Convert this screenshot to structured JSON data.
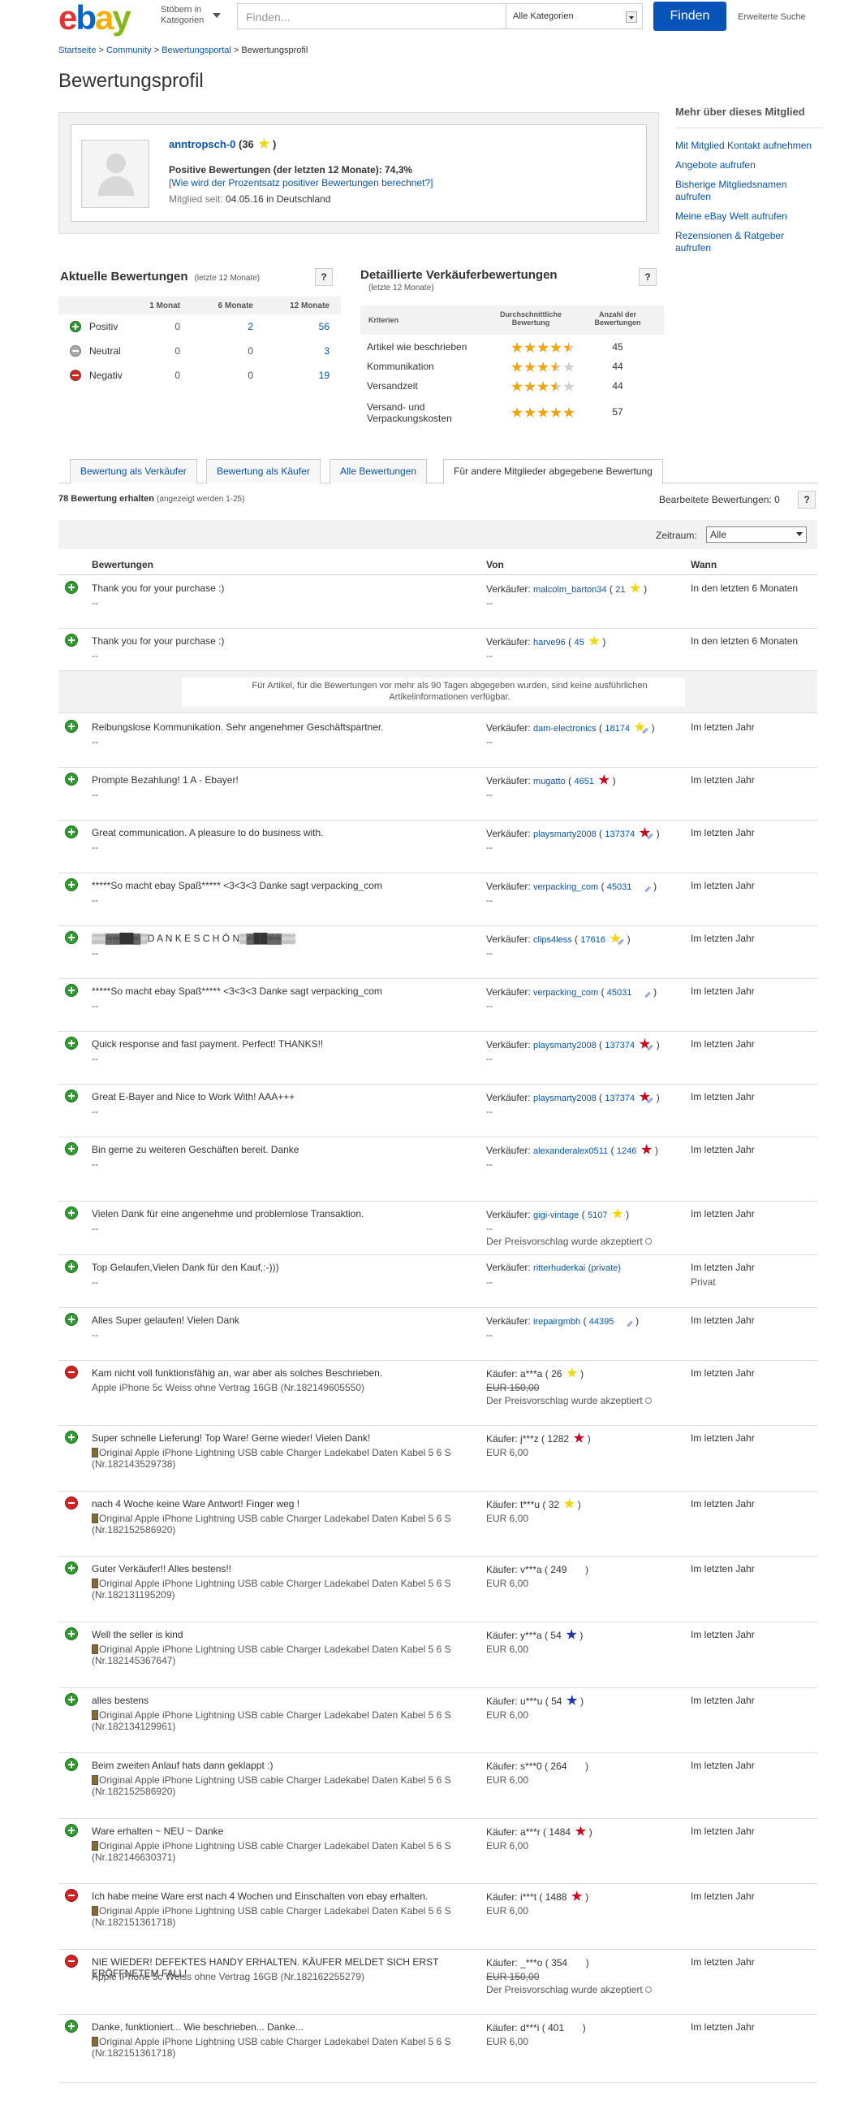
{
  "header": {
    "logo": {
      "e": "e",
      "b": "b",
      "a": "a",
      "y": "y"
    },
    "browse_label": "Stöbern in Kategorien",
    "search_placeholder": "Finden...",
    "category_value": "Alle Kategorien",
    "find_button": "Finden",
    "advanced_link": "Erweiterte Suche"
  },
  "breadcrumb": {
    "items": [
      "Startseite",
      "Community",
      "Bewertungsportal",
      "Bewertungsprofil"
    ],
    "sep": ">"
  },
  "page_title": "Bewertungsprofil",
  "profile": {
    "username": "anntropsch-0",
    "score_open": "(",
    "score": "36",
    "score_close": ")",
    "positive_text": "Positive Bewertungen (der letzten 12 Monate): 74,3%",
    "calc_link": "[Wie wird der Prozentsatz positiver Bewertungen berechnet?]",
    "since_label": "Mitglied seit:",
    "since_value": "04.05.16 in Deutschland"
  },
  "sidebar": {
    "title": "Mehr über dieses Mitglied",
    "links": [
      "Mit Mitglied Kontakt aufnehmen",
      "Angebote aufrufen",
      "Bisherige Mitgliedsnamen aufrufen",
      "Meine eBay Welt aufrufen",
      "Rezensionen & Ratgeber aufrufen"
    ]
  },
  "current_ratings": {
    "title": "Aktuelle Bewertungen",
    "period": "(letzte 12 Monate)",
    "help": "?",
    "columns": [
      "1 Monat",
      "6 Monate",
      "12 Monate"
    ],
    "rows": [
      {
        "label": "Positiv",
        "type": "pos",
        "v1": "0",
        "v6": "2",
        "v12": "56"
      },
      {
        "label": "Neutral",
        "type": "neu",
        "v1": "0",
        "v6": "0",
        "v12": "3"
      },
      {
        "label": "Negativ",
        "type": "neg",
        "v1": "0",
        "v6": "0",
        "v12": "19"
      }
    ]
  },
  "detailed_ratings": {
    "title": "Detaillierte Verkäuferbewertungen",
    "period": "(letzte 12 Monate)",
    "help": "?",
    "col_criteria": "Kriterien",
    "col_avg": "Durchschnittliche Bewertung",
    "col_count": "Anzahl der Bewertungen",
    "rows": [
      {
        "label": "Artikel wie beschrieben",
        "stars": 4.5,
        "count": "45"
      },
      {
        "label": "Kommunikation",
        "stars": 3.5,
        "count": "44"
      },
      {
        "label": "Versandzeit",
        "stars": 3.5,
        "count": "44"
      },
      {
        "label": "Versand- und Verpackungskosten",
        "stars": 5,
        "count": "57"
      }
    ]
  },
  "tabs": [
    "Bewertung als Verkäufer",
    "Bewertung als Käufer",
    "Alle Bewertungen",
    "Für andere Mitglieder abgegebene Bewertung"
  ],
  "count_text": "78 Bewertung erhalten",
  "count_sub": "(angezeigt werden 1-25)",
  "revised_text": "Bearbeitete Bewertungen: 0",
  "revised_help": "?",
  "timeframe_label": "Zeitraum:",
  "timeframe_value": "Alle",
  "columns": {
    "feedback": "Bewertungen",
    "from": "Von",
    "when": "Wann"
  },
  "info_text": "Für Artikel, für die Bewertungen vor mehr als 90 Tagen abgegeben wurden, sind keine ausführlichen Artikelinformationen verfügbar.",
  "info_icon": "i",
  "star_colors": {
    "yellow": "#f3d500",
    "red": "#d3001c",
    "turquoise": "#23c6b4",
    "blue": "#1d35b8"
  },
  "feedback": [
    {
      "type": "p",
      "comment": "Thank you for your purchase :)",
      "sub": "--",
      "role": "Verkäufer:",
      "user": "malcolm_barton34",
      "score": "21",
      "star": "yellow",
      "shoot": false,
      "line2": "--",
      "when": "In den letzten 6 Monaten"
    },
    {
      "type": "p",
      "comment": "Thank you for your purchase :)",
      "sub": "--",
      "role": "Verkäufer:",
      "user": "harve96",
      "score": "45",
      "star": "yellow",
      "shoot": false,
      "line2": "--",
      "when": "In den letzten 6 Monaten"
    },
    {
      "type": "p",
      "comment": "Reibungslose Kommunikation. Sehr angenehmer Geschäftspartner.",
      "sub": "--",
      "role": "Verkäufer:",
      "user": "dam-electronics",
      "score": "18174",
      "star": "yellow",
      "shoot": true,
      "line2": "--",
      "when": "Im letzten Jahr"
    },
    {
      "type": "p",
      "comment": "Prompte Bezahlung! 1 A - Ebayer!",
      "sub": "--",
      "role": "Verkäufer:",
      "user": "mugatto",
      "score": "4651",
      "star": "red",
      "shoot": false,
      "line2": "--",
      "when": "Im letzten Jahr"
    },
    {
      "type": "p",
      "comment": "Great communication. A pleasure to do business with.",
      "sub": "--",
      "role": "Verkäufer:",
      "user": "playsmarty2008",
      "score": "137374",
      "star": "red",
      "shoot": true,
      "line2": "--",
      "when": "Im letzten Jahr"
    },
    {
      "type": "p",
      "comment": "*****So macht ebay Spaß***** <3<3<3 Danke sagt verpacking_com",
      "sub": "--",
      "role": "Verkäufer:",
      "user": "verpacking_com",
      "score": "45031",
      "star": "turquoise",
      "shoot": true,
      "line2": "--",
      "when": "Im letzten Jahr"
    },
    {
      "type": "p",
      "comment": "▒▒▓▓██▓▒D A N K E S C H Ö N▒▓██▓▓▒▒",
      "sub": "--",
      "role": "Verkäufer:",
      "user": "clips4less",
      "score": "17616",
      "star": "yellow",
      "shoot": true,
      "line2": "--",
      "when": "Im letzten Jahr"
    },
    {
      "type": "p",
      "comment": "*****So macht ebay Spaß***** <3<3<3 Danke sagt verpacking_com",
      "sub": "--",
      "role": "Verkäufer:",
      "user": "verpacking_com",
      "score": "45031",
      "star": "turquoise",
      "shoot": true,
      "line2": "--",
      "when": "Im letzten Jahr"
    },
    {
      "type": "p",
      "comment": "Quick response and fast payment. Perfect! THANKS!!",
      "sub": "--",
      "role": "Verkäufer:",
      "user": "playsmarty2008",
      "score": "137374",
      "star": "red",
      "shoot": true,
      "line2": "--",
      "when": "Im letzten Jahr"
    },
    {
      "type": "p",
      "comment": "Great E-Bayer and Nice to Work With! AAA+++",
      "sub": "--",
      "role": "Verkäufer:",
      "user": "playsmarty2008",
      "score": "137374",
      "star": "red",
      "shoot": true,
      "line2": "--",
      "when": "Im letzten Jahr"
    },
    {
      "type": "p",
      "comment": "Bin gerne zu weiteren Geschäften bereit. Danke",
      "sub": "--",
      "role": "Verkäufer:",
      "user": "alexanderalex0511",
      "score": "1246",
      "star": "red",
      "shoot": false,
      "line2": "--",
      "when": "Im letzten Jahr"
    },
    {
      "type": "p",
      "comment": "Vielen Dank für eine angenehme und problemlose Transaktion.",
      "sub": "--",
      "role": "Verkäufer:",
      "user": "gigi-vintage",
      "score": "5107",
      "star": "yellow",
      "shoot": false,
      "line2": "--",
      "line3": "Der Preisvorschlag wurde akzeptiert",
      "when": "Im letzten Jahr"
    },
    {
      "type": "p",
      "comment": "Top Gelaufen,Vielen Dank für den Kauf,:-)))",
      "sub": "--",
      "role": "Verkäufer:",
      "user": "ritterhuderkai",
      "private": "(private)",
      "line2": "--",
      "when": "Im letzten Jahr",
      "when2": "Privat"
    },
    {
      "type": "p",
      "comment": "Alles Super gelaufen! Vielen Dank",
      "sub": "--",
      "role": "Verkäufer:",
      "user": "irepairgmbh",
      "score": "44395",
      "star": "turquoise",
      "shoot": true,
      "line2": "--",
      "when": "Im letzten Jahr"
    },
    {
      "type": "n",
      "comment": "Kam nicht voll funktionsfähig an, war aber als solches Beschrieben.",
      "sub": "Apple iPhone 5c Weiss ohne Vertrag 16GB (Nr.182149605550)",
      "role": "Käufer:",
      "userplain": "a***a",
      "score": "26",
      "star": "yellow",
      "shoot": false,
      "price_strike": "EUR 150,00",
      "line3": "Der Preisvorschlag wurde akzeptiert",
      "when": "Im letzten Jahr"
    },
    {
      "type": "p",
      "comment": "Super schnelle Lieferung! Top Ware! Gerne wieder! Vielen Dank!",
      "sub": "Original Apple iPhone Lightning USB cable Charger Ladekabel Daten Kabel 5 6 S (Nr.182143529738)",
      "gicon": true,
      "role": "Käufer:",
      "userplain": "j***z",
      "score": "1282",
      "star": "red",
      "shoot": false,
      "price": "EUR 6,00",
      "when": "Im letzten Jahr"
    },
    {
      "type": "n",
      "comment": "nach 4 Woche keine Ware Antwort! Finger weg !",
      "sub": "Original Apple iPhone Lightning USB cable Charger Ladekabel Daten Kabel 5 6 S (Nr.182152586920)",
      "gicon": true,
      "role": "Käufer:",
      "userplain": "t***u",
      "score": "32",
      "star": "yellow",
      "shoot": false,
      "price": "EUR 6,00",
      "when": "Im letzten Jahr"
    },
    {
      "type": "p",
      "comment": "Guter Verkäufer!! Alles bestens!!",
      "sub": "Original Apple iPhone Lightning USB cable Charger Ladekabel Daten Kabel 5 6 S (Nr.182131195209)",
      "gicon": true,
      "role": "Käufer:",
      "userplain": "v***a",
      "score": "249",
      "star": "turquoise",
      "shoot": false,
      "price": "EUR 6,00",
      "when": "Im letzten Jahr"
    },
    {
      "type": "p",
      "comment": "Well the seller is kind",
      "sub": "Original Apple iPhone Lightning USB cable Charger Ladekabel Daten Kabel 5 6 S (Nr.182145367647)",
      "gicon": true,
      "role": "Käufer:",
      "userplain": "y***a",
      "score": "54",
      "star": "blue",
      "shoot": false,
      "price": "EUR 6,00",
      "when": "Im letzten Jahr"
    },
    {
      "type": "p",
      "comment": "alles bestens",
      "sub": "Original Apple iPhone Lightning USB cable Charger Ladekabel Daten Kabel 5 6 S (Nr.182134129961)",
      "gicon": true,
      "role": "Käufer:",
      "userplain": "u***u",
      "score": "54",
      "star": "blue",
      "shoot": false,
      "price": "EUR 6,00",
      "when": "Im letzten Jahr"
    },
    {
      "type": "p",
      "comment": "Beim zweiten Anlauf hats dann geklappt :)",
      "sub": "Original Apple iPhone Lightning USB cable Charger Ladekabel Daten Kabel 5 6 S (Nr.182152586920)",
      "gicon": true,
      "role": "Käufer:",
      "userplain": "s***0",
      "score": "264",
      "star": "turquoise",
      "shoot": false,
      "price": "EUR 6,00",
      "when": "Im letzten Jahr"
    },
    {
      "type": "p",
      "comment": "Ware erhalten ~ NEU ~ Danke",
      "sub": "Original Apple iPhone Lightning USB cable Charger Ladekabel Daten Kabel 5 6 S (Nr.182146630371)",
      "gicon": true,
      "role": "Käufer:",
      "userplain": "a***r",
      "score": "1484",
      "star": "red",
      "shoot": false,
      "price": "EUR 6,00",
      "when": "Im letzten Jahr"
    },
    {
      "type": "n",
      "comment": "Ich habe meine Ware erst nach 4 Wochen und Einschalten von ebay erhalten.",
      "sub": "Original Apple iPhone Lightning USB cable Charger Ladekabel Daten Kabel 5 6 S (Nr.182151361718)",
      "gicon": true,
      "role": "Käufer:",
      "userplain": "i***t",
      "score": "1488",
      "star": "red",
      "shoot": false,
      "price": "EUR 6,00",
      "when": "Im letzten Jahr"
    },
    {
      "type": "n",
      "comment": "NIE WIEDER! DEFEKTES HANDY ERHALTEN. KÄUFER MELDET SICH ERST ERÖFFNETEM FALL!",
      "sub": "Apple iPhone 5c Weiss ohne Vertrag 16GB (Nr.182162255279)",
      "role": "Käufer:",
      "userplain": "_***o",
      "score": "354",
      "star": "turquoise",
      "shoot": false,
      "price_strike": "EUR 150,00",
      "line3": "Der Preisvorschlag wurde akzeptiert",
      "when": "Im letzten Jahr"
    },
    {
      "type": "p",
      "comment": "Danke, funktioniert... Wie beschrieben... Danke...",
      "sub": "Original Apple iPhone Lightning USB cable Charger Ladekabel Daten Kabel 5 6 S (Nr.182151361718)",
      "gicon": true,
      "role": "Käufer:",
      "userplain": "d***i",
      "score": "401",
      "star": "turquoise",
      "shoot": false,
      "price": "EUR 6,00",
      "when": "Im letzten Jahr"
    }
  ]
}
